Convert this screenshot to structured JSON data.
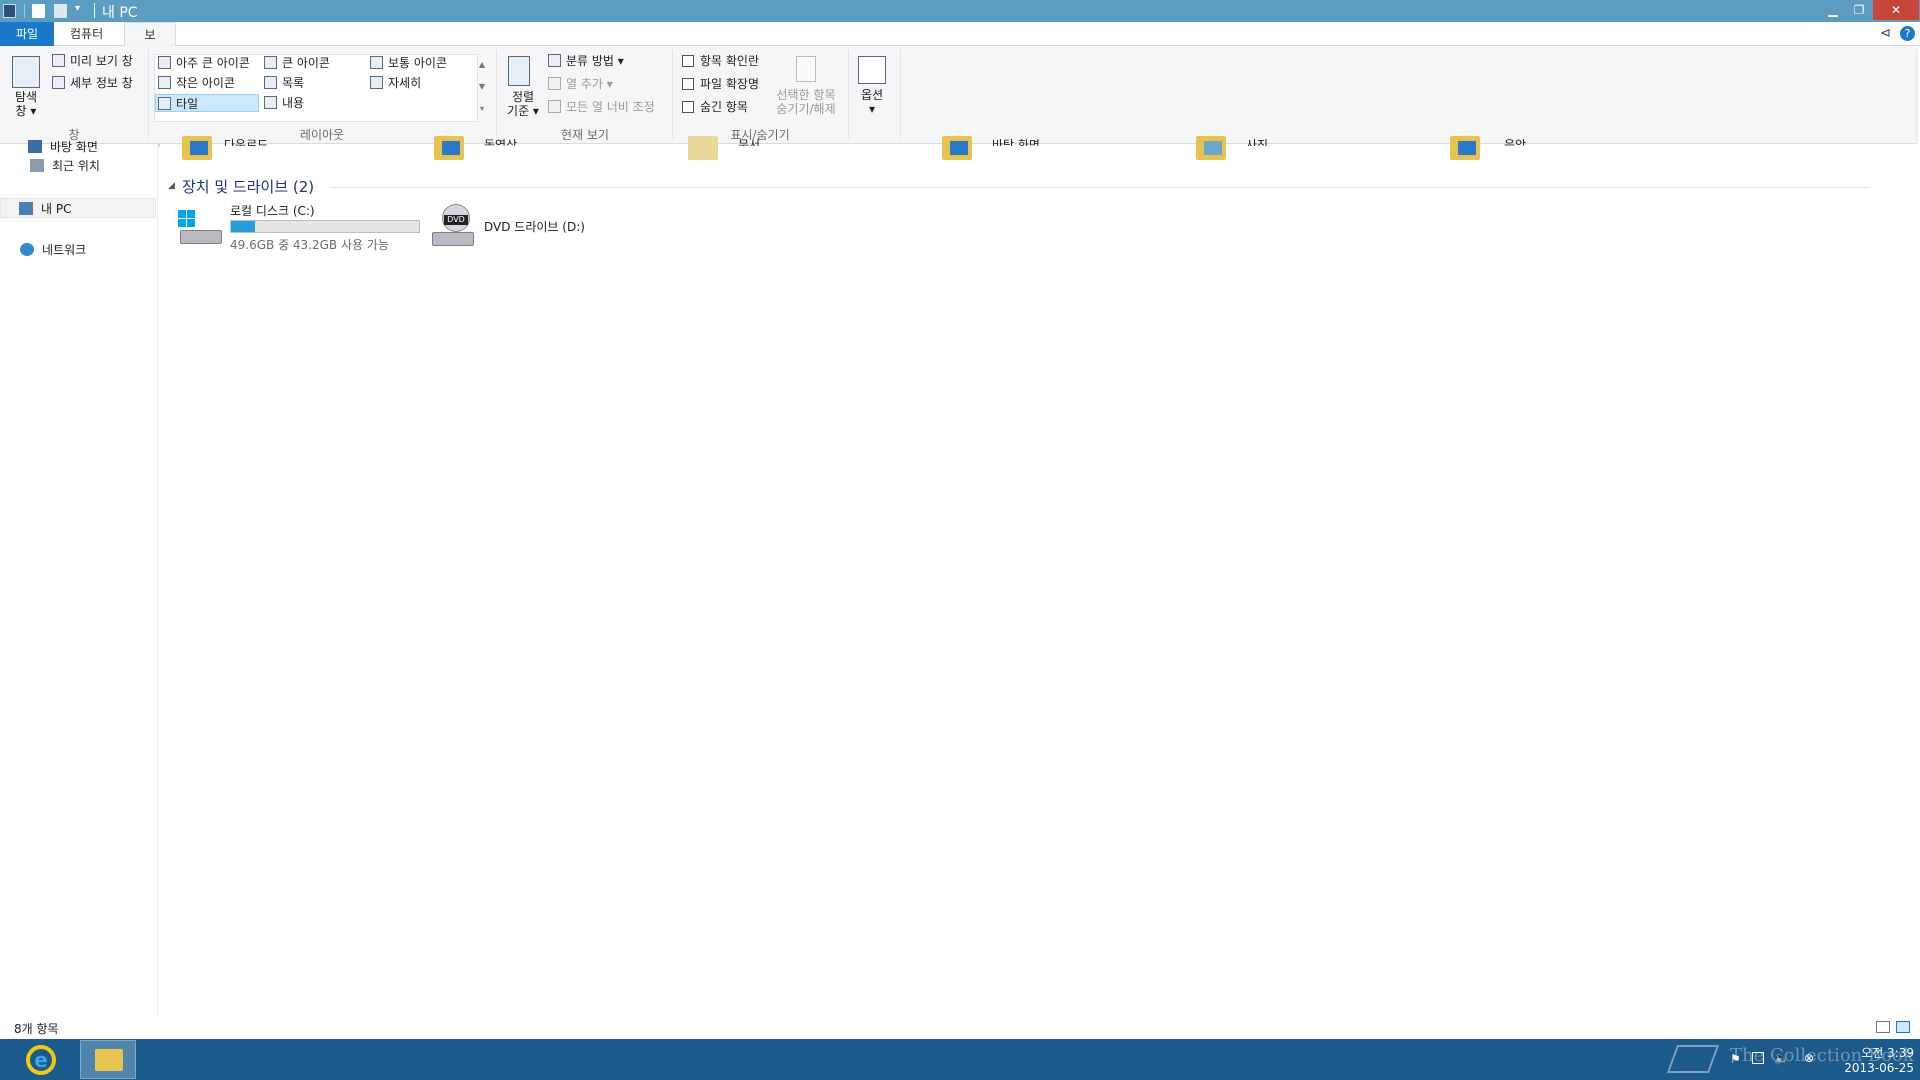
{
  "window": {
    "title": "내 PC"
  },
  "tabs": {
    "file": "파일",
    "computer": "컴퓨터",
    "view": "보기"
  },
  "ribbon": {
    "pane_group": {
      "nav_pane": "탐색\n창 ▾",
      "preview_pane": "미리 보기 창",
      "details_pane": "세부 정보 창",
      "label": "창"
    },
    "layout_group": {
      "extra_large": "아주 큰 아이콘",
      "large": "큰 아이콘",
      "medium": "보통 아이콘",
      "small": "작은 아이콘",
      "list": "목록",
      "details": "자세히",
      "tiles": "타일",
      "content": "내용",
      "label": "레이아웃"
    },
    "current_view_group": {
      "sort_by": "정렬\n기준 ▾",
      "group_by": "분류 방법 ▾",
      "add_columns": "열 추가 ▾",
      "size_columns": "모든 열 너비 조정",
      "label": "현재 보기"
    },
    "show_hide_group": {
      "item_checkboxes": "항목 확인란",
      "file_extensions": "파일 확장명",
      "hidden_items": "숨긴 항목",
      "hide_selected": "선택한 항목\n숨기기/해제",
      "label": "표시/숨기기"
    },
    "options": "옵션\n▾"
  },
  "nav": {
    "desktop": "바탕 화면",
    "recent": "최근 위치",
    "mypc": "내 PC",
    "network": "네트워크"
  },
  "folders_partial": [
    "다운로드",
    "동영상",
    "문서",
    "바탕 화면",
    "사진",
    "음악"
  ],
  "devices": {
    "header": "장치 및 드라이브 (2)",
    "local_disk": {
      "name": "로컬 디스크 (C:)",
      "info": "49.6GB 중 43.2GB 사용 가능",
      "used_fraction": 0.13
    },
    "dvd": {
      "name": "DVD 드라이브 (D:)"
    }
  },
  "status": {
    "count": "8개 항목"
  },
  "taskbar": {
    "time": "오전 3:39",
    "date": "2013-06-25",
    "watermark": "The Collection Book"
  }
}
